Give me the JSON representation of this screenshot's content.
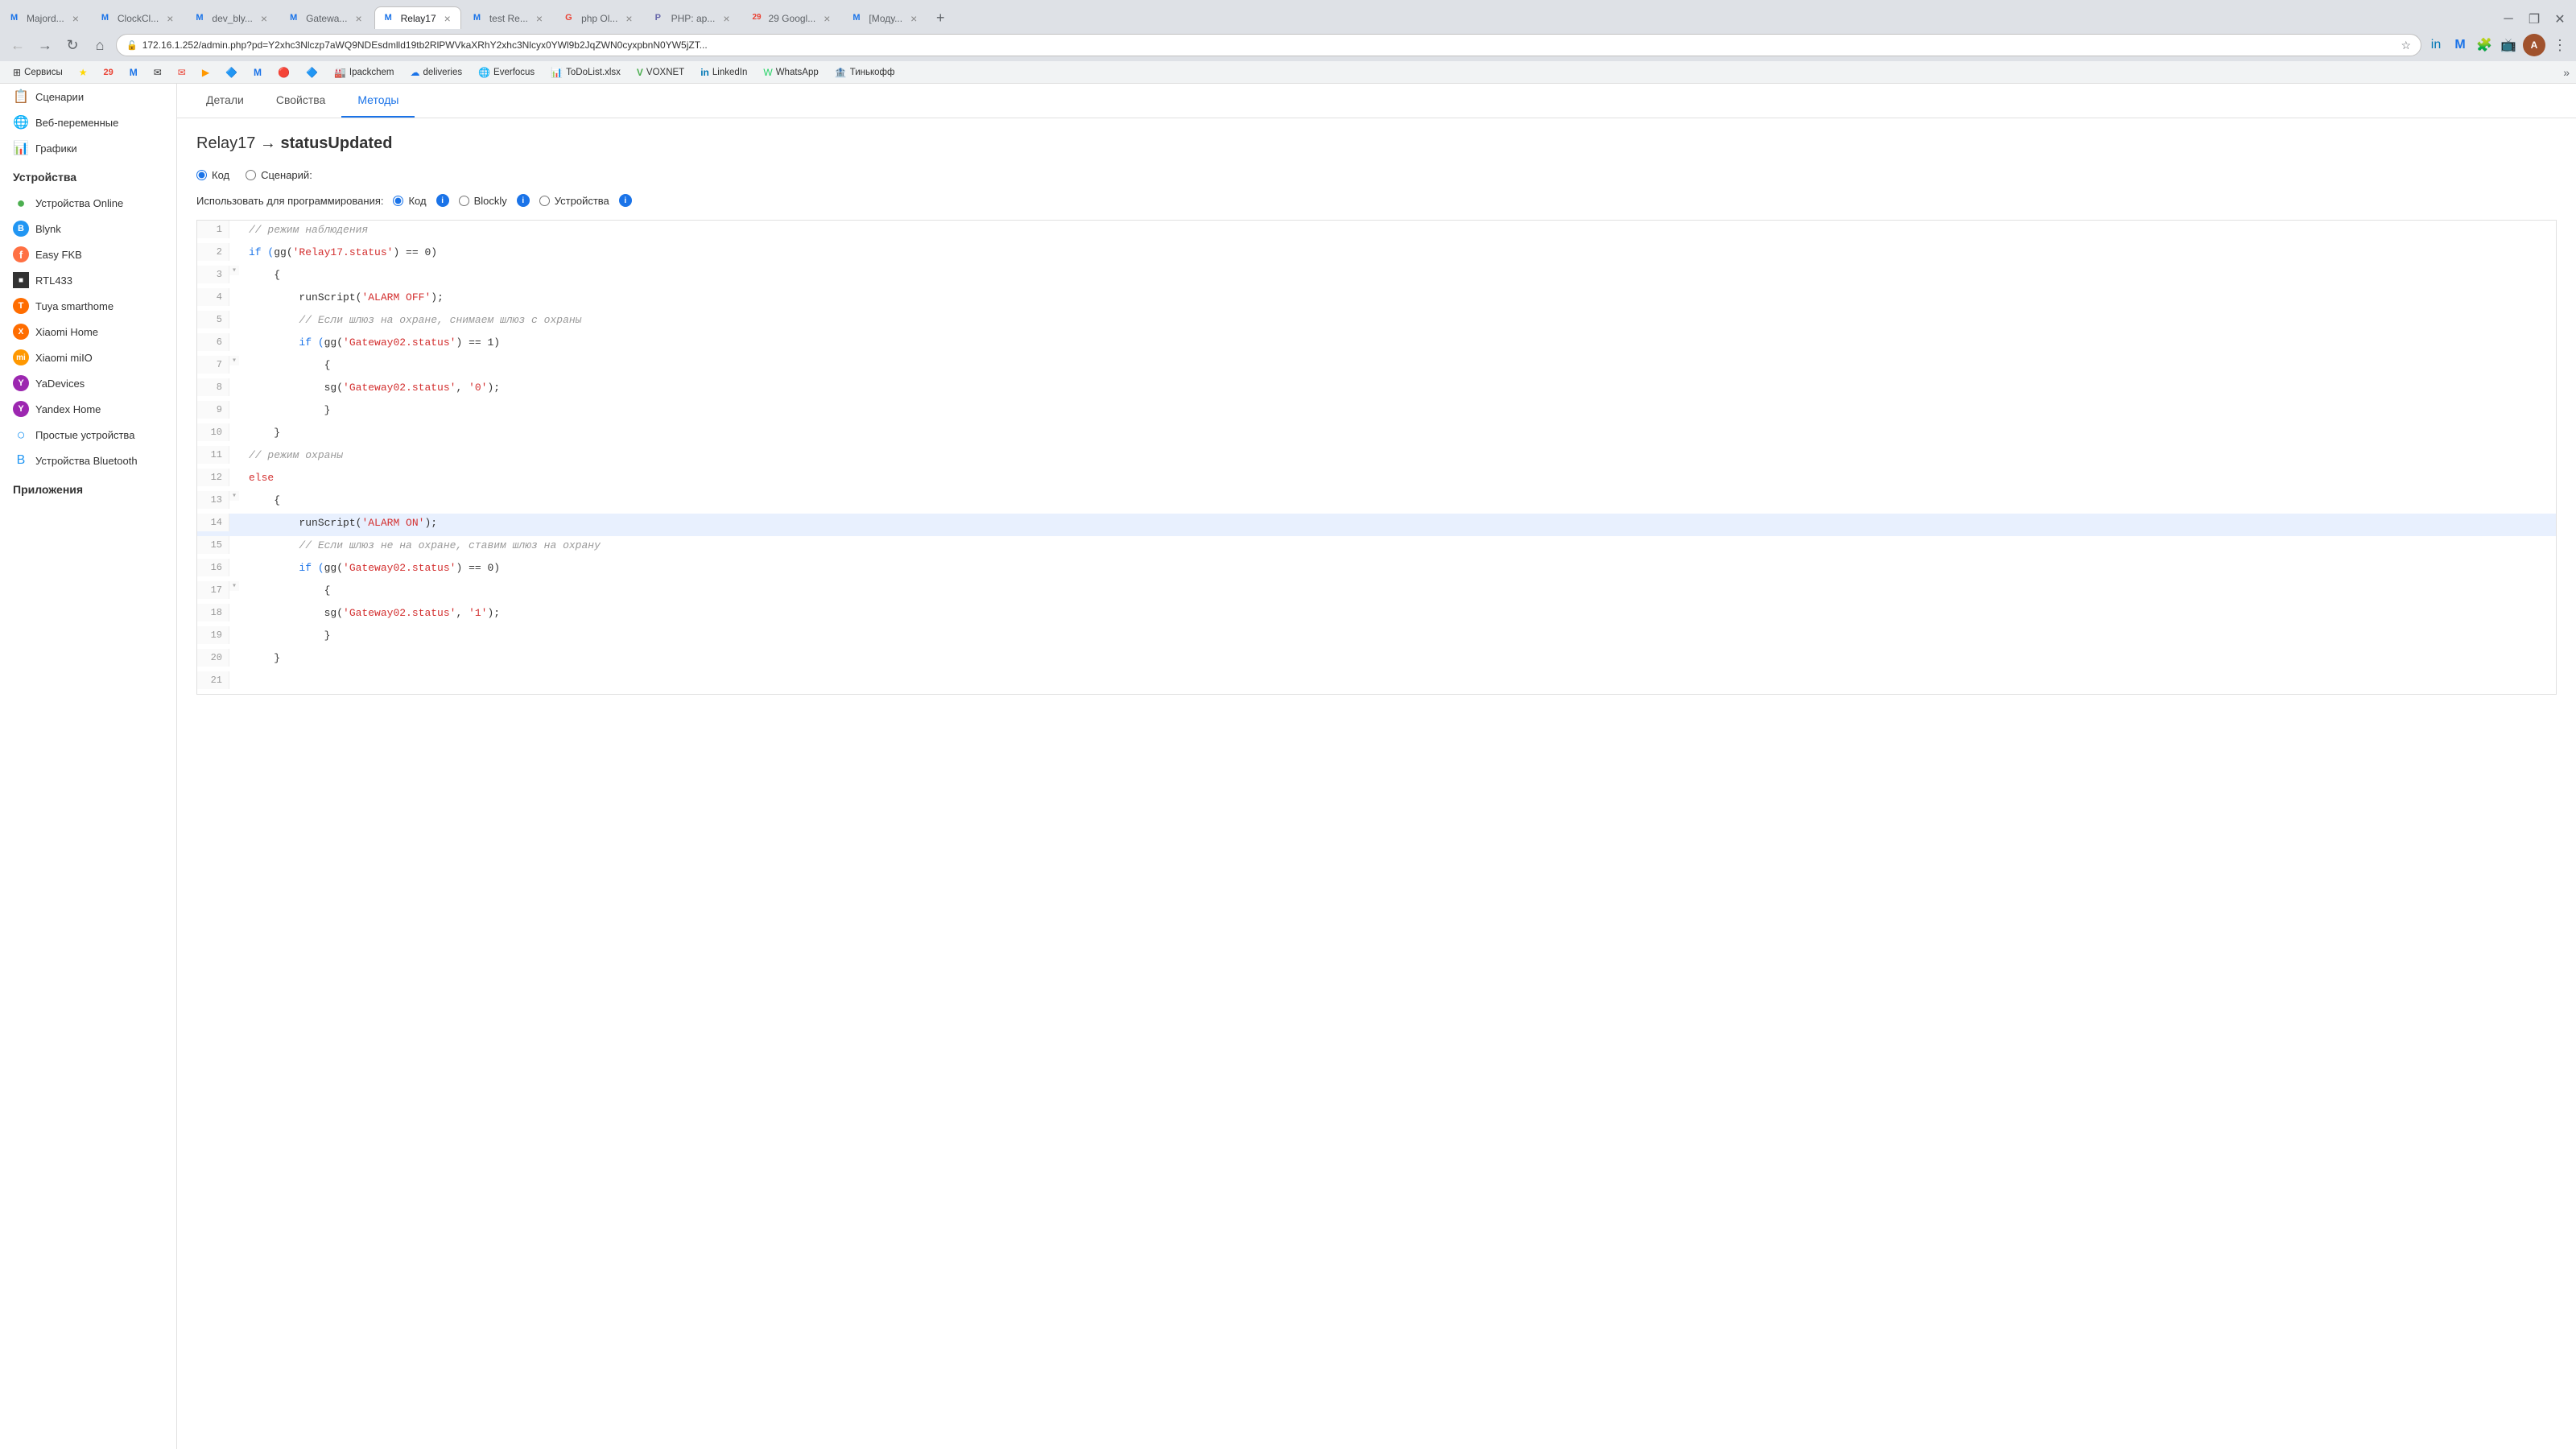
{
  "browser": {
    "tabs": [
      {
        "id": "t1",
        "label": "Majord...",
        "active": false,
        "favicon": "M"
      },
      {
        "id": "t2",
        "label": "ClockCl...",
        "active": false,
        "favicon": "M"
      },
      {
        "id": "t3",
        "label": "dev_bly...",
        "active": false,
        "favicon": "M"
      },
      {
        "id": "t4",
        "label": "Gatewa...",
        "active": false,
        "favicon": "M"
      },
      {
        "id": "t5",
        "label": "Relay17",
        "active": true,
        "favicon": "M"
      },
      {
        "id": "t6",
        "label": "test Re...",
        "active": false,
        "favicon": "M"
      },
      {
        "id": "t7",
        "label": "php Ol...",
        "active": false,
        "favicon": "G"
      },
      {
        "id": "t8",
        "label": "PHP: ap...",
        "active": false,
        "favicon": "P"
      },
      {
        "id": "t9",
        "label": "29 Googl...",
        "active": false,
        "favicon": "29"
      },
      {
        "id": "t10",
        "label": "[Моду...",
        "active": false,
        "favicon": "M"
      }
    ],
    "address": "172.16.1.252/admin.php?pd=Y2xhc3Nlczp7aWQ9NDEsdmlld19tb2RlPWVkaXRhY2xhc3Nlcyx0YWl9b2JqZWN0cyxpbnN0YW5jZT...",
    "bookmarks": [
      {
        "label": "Сервисы",
        "icon": "⊞"
      },
      {
        "label": "",
        "icon": "★"
      },
      {
        "label": "",
        "icon": "29"
      },
      {
        "label": "",
        "icon": "M"
      },
      {
        "label": "",
        "icon": "✉"
      },
      {
        "label": "",
        "icon": "✉"
      },
      {
        "label": "",
        "icon": "▶"
      },
      {
        "label": "",
        "icon": "🔷"
      },
      {
        "label": "",
        "icon": "M"
      },
      {
        "label": "",
        "icon": "🔴"
      },
      {
        "label": "",
        "icon": "🔷"
      },
      {
        "label": "Ipackchem",
        "icon": "🏭"
      },
      {
        "label": "deliveries",
        "icon": "☁"
      },
      {
        "label": "Everfocus",
        "icon": "🌐"
      },
      {
        "label": "ToDoList.xlsx",
        "icon": "📊"
      },
      {
        "label": "VOXNET",
        "icon": "V"
      },
      {
        "label": "LinkedIn",
        "icon": "in"
      },
      {
        "label": "WhatsApp",
        "icon": "W"
      },
      {
        "label": "Тинькофф",
        "icon": "T"
      }
    ]
  },
  "sidebar": {
    "sections": [
      {
        "title": "",
        "items": [
          {
            "label": "Сценарии",
            "icon": "📋",
            "iconType": "emoji"
          },
          {
            "label": "Веб-переменные",
            "icon": "🌐",
            "iconType": "emoji"
          },
          {
            "label": "Графики",
            "icon": "📊",
            "iconType": "emoji"
          }
        ]
      },
      {
        "title": "Устройства",
        "items": [
          {
            "label": "Устройства Online",
            "icon": "●",
            "iconColor": "green"
          },
          {
            "label": "Blynk",
            "icon": "B",
            "iconColor": "blue"
          },
          {
            "label": "Easy FKB",
            "icon": "f",
            "iconColor": "orange"
          },
          {
            "label": "RTL433",
            "icon": "■",
            "iconColor": "dark"
          },
          {
            "label": "Tuya smarthome",
            "icon": "T",
            "iconColor": "orange"
          },
          {
            "label": "Xiaomi Home",
            "icon": "X",
            "iconColor": "orange"
          },
          {
            "label": "Xiaomi miIO",
            "icon": "mi",
            "iconColor": "orange"
          },
          {
            "label": "YaDevices",
            "icon": "Y",
            "iconColor": "purple"
          },
          {
            "label": "Yandex Home",
            "icon": "Y",
            "iconColor": "purple"
          },
          {
            "label": "Простые устройства",
            "icon": "○",
            "iconColor": "blue"
          },
          {
            "label": "Устройства Bluetooth",
            "icon": "Β",
            "iconColor": "blue"
          }
        ]
      },
      {
        "title": "Приложения",
        "items": []
      }
    ]
  },
  "content": {
    "tabs": [
      "Детали",
      "Свойства",
      "Методы"
    ],
    "active_tab": "Методы",
    "page_title_prefix": "Relay17 → ",
    "page_title_method": "statusUpdated",
    "radio_options": [
      {
        "label": "Код",
        "checked": true
      },
      {
        "label": "Сценарий:",
        "checked": false
      }
    ],
    "programming_label": "Использовать для программирования:",
    "programming_options": [
      {
        "label": "Код",
        "checked": true,
        "has_info": true
      },
      {
        "label": "Blockly",
        "checked": false,
        "has_info": true
      },
      {
        "label": "Устройства",
        "checked": false,
        "has_info": true
      }
    ],
    "code_lines": [
      {
        "num": 1,
        "marker": "",
        "highlight": "",
        "content": [
          {
            "text": "// режим наблюдения",
            "cls": "kw-comment"
          }
        ]
      },
      {
        "num": 2,
        "marker": "",
        "highlight": "",
        "content": [
          {
            "text": "if (",
            "cls": "kw-blue"
          },
          {
            "text": "gg(",
            "cls": "kw-black"
          },
          {
            "text": "'Relay17.status'",
            "cls": "kw-red"
          },
          {
            "text": ") == 0)",
            "cls": "kw-black"
          }
        ]
      },
      {
        "num": 3,
        "marker": "▾",
        "highlight": "",
        "content": [
          {
            "text": "    {",
            "cls": "kw-black"
          }
        ]
      },
      {
        "num": 4,
        "marker": "",
        "highlight": "",
        "content": [
          {
            "text": "        runScript(",
            "cls": "kw-black"
          },
          {
            "text": "'ALARM OFF'",
            "cls": "kw-red"
          },
          {
            "text": ");",
            "cls": "kw-black"
          }
        ]
      },
      {
        "num": 5,
        "marker": "",
        "highlight": "",
        "content": [
          {
            "text": "        // Если шлюз на охране, снимаем шлюз с охраны",
            "cls": "kw-comment"
          }
        ]
      },
      {
        "num": 6,
        "marker": "",
        "highlight": "",
        "content": [
          {
            "text": "        if (",
            "cls": "kw-blue"
          },
          {
            "text": "gg(",
            "cls": "kw-black"
          },
          {
            "text": "'Gateway02.status'",
            "cls": "kw-red"
          },
          {
            "text": ") == 1)",
            "cls": "kw-black"
          }
        ]
      },
      {
        "num": 7,
        "marker": "▾",
        "highlight": "",
        "content": [
          {
            "text": "            {",
            "cls": "kw-black"
          }
        ]
      },
      {
        "num": 8,
        "marker": "",
        "highlight": "",
        "content": [
          {
            "text": "            sg(",
            "cls": "kw-black"
          },
          {
            "text": "'Gateway02.status'",
            "cls": "kw-red"
          },
          {
            "text": ", ",
            "cls": "kw-black"
          },
          {
            "text": "'0'",
            "cls": "kw-red"
          },
          {
            "text": ");",
            "cls": "kw-black"
          }
        ]
      },
      {
        "num": 9,
        "marker": "",
        "highlight": "",
        "content": [
          {
            "text": "            }",
            "cls": "kw-black"
          }
        ]
      },
      {
        "num": 10,
        "marker": "",
        "highlight": "",
        "content": [
          {
            "text": "    }",
            "cls": "kw-black"
          }
        ]
      },
      {
        "num": 11,
        "marker": "",
        "highlight": "",
        "content": [
          {
            "text": "// режим охраны",
            "cls": "kw-comment"
          }
        ]
      },
      {
        "num": 12,
        "marker": "",
        "highlight": "",
        "content": [
          {
            "text": "else",
            "cls": "kw-red"
          }
        ]
      },
      {
        "num": 13,
        "marker": "▾",
        "highlight": "",
        "content": [
          {
            "text": "    {",
            "cls": "kw-black"
          }
        ]
      },
      {
        "num": 14,
        "marker": "",
        "highlight": "blue",
        "content": [
          {
            "text": "        runScript(",
            "cls": "kw-black"
          },
          {
            "text": "'ALARM ON'",
            "cls": "kw-red"
          },
          {
            "text": ");",
            "cls": "kw-black"
          }
        ]
      },
      {
        "num": 15,
        "marker": "",
        "highlight": "",
        "content": [
          {
            "text": "        // Если шлюз не на охране, ставим шлюз на охрану",
            "cls": "kw-comment"
          }
        ]
      },
      {
        "num": 16,
        "marker": "",
        "highlight": "",
        "content": [
          {
            "text": "        if (",
            "cls": "kw-blue"
          },
          {
            "text": "gg(",
            "cls": "kw-black"
          },
          {
            "text": "'Gateway02.status'",
            "cls": "kw-red"
          },
          {
            "text": ") == 0)",
            "cls": "kw-black"
          }
        ]
      },
      {
        "num": 17,
        "marker": "▾",
        "highlight": "",
        "content": [
          {
            "text": "            {",
            "cls": "kw-black"
          }
        ]
      },
      {
        "num": 18,
        "marker": "",
        "highlight": "",
        "content": [
          {
            "text": "            sg(",
            "cls": "kw-black"
          },
          {
            "text": "'Gateway02.status'",
            "cls": "kw-red"
          },
          {
            "text": ", ",
            "cls": "kw-black"
          },
          {
            "text": "'1'",
            "cls": "kw-red"
          },
          {
            "text": ");",
            "cls": "kw-black"
          }
        ]
      },
      {
        "num": 19,
        "marker": "",
        "highlight": "",
        "content": [
          {
            "text": "            }",
            "cls": "kw-black"
          }
        ]
      },
      {
        "num": 20,
        "marker": "",
        "highlight": "",
        "content": [
          {
            "text": "    }",
            "cls": "kw-black"
          }
        ]
      },
      {
        "num": 21,
        "marker": "",
        "highlight": "",
        "content": [
          {
            "text": "",
            "cls": "kw-black"
          }
        ]
      }
    ]
  }
}
